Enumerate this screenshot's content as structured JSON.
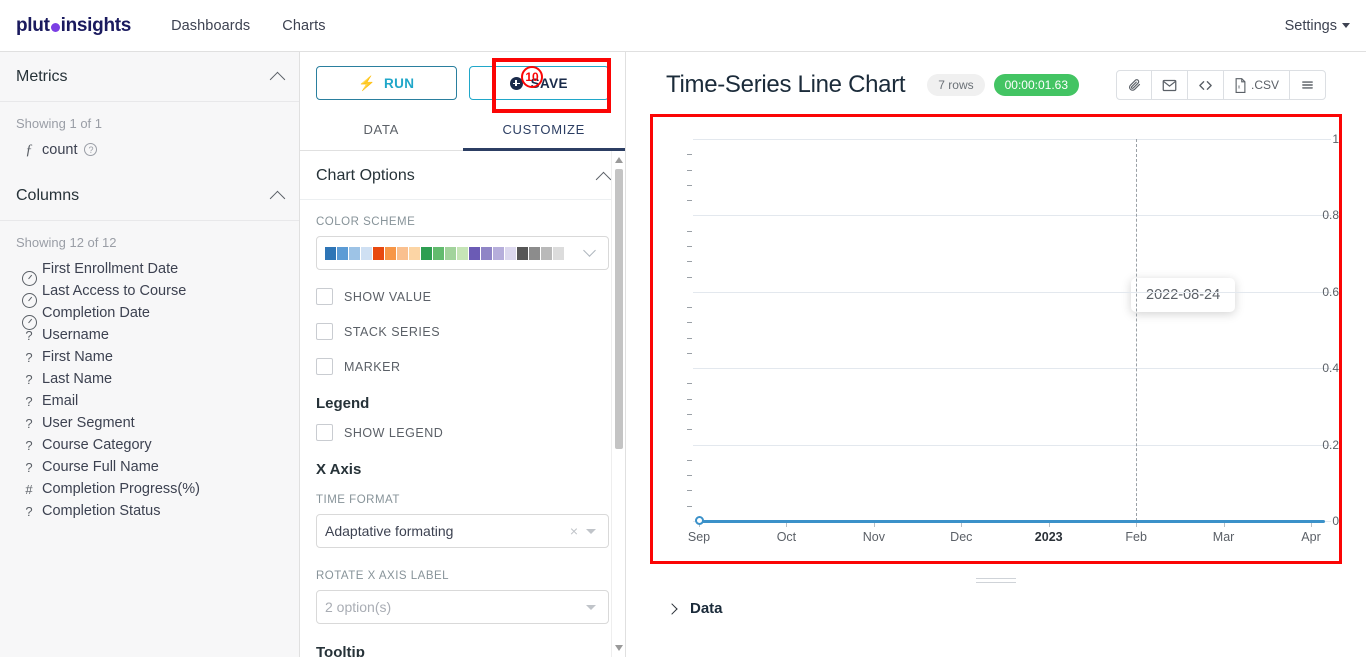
{
  "navbar": {
    "logo_pre": "plut",
    "logo_post": " insights",
    "links": [
      {
        "label": "Dashboards"
      },
      {
        "label": "Charts"
      }
    ],
    "settings_label": "Settings"
  },
  "sidebar": {
    "metrics": {
      "title": "Metrics",
      "showing": "Showing 1 of 1",
      "items": [
        {
          "icon": "function-icon",
          "kind": "fx",
          "label": "count",
          "help": "?"
        }
      ]
    },
    "columns": {
      "title": "Columns",
      "showing": "Showing 12 of 12",
      "items": [
        {
          "icon": "clock-icon",
          "kind": "clock",
          "glyph": "",
          "label": "First Enrollment Date"
        },
        {
          "icon": "clock-icon",
          "kind": "clock",
          "glyph": "",
          "label": "Last Access to Course"
        },
        {
          "icon": "clock-icon",
          "kind": "clock",
          "glyph": "",
          "label": "Completion Date"
        },
        {
          "icon": "string-icon",
          "kind": "str",
          "glyph": "?",
          "label": "Username"
        },
        {
          "icon": "string-icon",
          "kind": "str",
          "glyph": "?",
          "label": "First Name"
        },
        {
          "icon": "string-icon",
          "kind": "str",
          "glyph": "?",
          "label": "Last Name"
        },
        {
          "icon": "string-icon",
          "kind": "str",
          "glyph": "?",
          "label": "Email"
        },
        {
          "icon": "string-icon",
          "kind": "str",
          "glyph": "?",
          "label": "User Segment"
        },
        {
          "icon": "string-icon",
          "kind": "str",
          "glyph": "?",
          "label": "Course Category"
        },
        {
          "icon": "string-icon",
          "kind": "str",
          "glyph": "?",
          "label": "Course Full Name"
        },
        {
          "icon": "number-icon",
          "kind": "num",
          "glyph": "#",
          "label": "Completion Progress(%)"
        },
        {
          "icon": "string-icon",
          "kind": "str",
          "glyph": "?",
          "label": "Completion Status"
        }
      ]
    }
  },
  "control_panel": {
    "run_label": "RUN",
    "save_label": "SAVE",
    "tabs": [
      {
        "label": "DATA",
        "active": false
      },
      {
        "label": "CUSTOMIZE",
        "active": true
      }
    ],
    "chart_options": {
      "title": "Chart Options",
      "color_scheme_label": "COLOR SCHEME",
      "color_scheme_swatches": [
        "#2e75b6",
        "#5b9bd5",
        "#9dc3e6",
        "#cfe0f3",
        "#e8490f",
        "#f79646",
        "#fac08f",
        "#fcd5a5",
        "#2e9e52",
        "#62bb6e",
        "#a2d39c",
        "#c6e5b7",
        "#6b5bb5",
        "#8f85c6",
        "#b6aedb",
        "#dcd8ee",
        "#565656",
        "#8c8c8c",
        "#b9b9b9",
        "#dcdcdc"
      ],
      "checkboxes": [
        {
          "label": "SHOW VALUE",
          "checked": false
        },
        {
          "label": "STACK SERIES",
          "checked": false
        },
        {
          "label": "MARKER",
          "checked": false
        }
      ]
    },
    "legend": {
      "title": "Legend",
      "show_legend_label": "SHOW LEGEND",
      "show_legend_checked": false
    },
    "x_axis": {
      "title": "X Axis",
      "time_format_label": "TIME FORMAT",
      "time_format_value": "Adaptative formating",
      "rotate_label": "ROTATE X AXIS LABEL",
      "rotate_placeholder": "2 option(s)"
    },
    "tooltip_title": "Tooltip"
  },
  "chart": {
    "title": "Time-Series Line Chart",
    "rows_badge": "7 rows",
    "time_badge": "00:00:01.63",
    "toolbar": [
      {
        "name": "link-icon",
        "glyph": "✁",
        "label": ""
      },
      {
        "name": "email-icon",
        "glyph": "✉",
        "label": ""
      },
      {
        "name": "code-icon",
        "glyph": "<>",
        "label": ""
      },
      {
        "name": "csv-icon",
        "glyph": "⬚",
        "label": ".CSV"
      },
      {
        "name": "menu-icon",
        "glyph": "≡",
        "label": ""
      }
    ],
    "tooltip_value": "2022-08-24",
    "data_section_label": "Data"
  },
  "annotations": {
    "save_badge_number": "10",
    "highlight_color": "#fb0505"
  },
  "chart_data": {
    "type": "line",
    "title": "Time-Series Line Chart",
    "xlabel": "",
    "ylabel": "",
    "ylim": [
      0,
      1
    ],
    "yticks": [
      0,
      0.2,
      0.4,
      0.6,
      0.8,
      1
    ],
    "ytick_labels": [
      "0",
      "0.2",
      "0.4",
      "0.6",
      "0.8",
      "1"
    ],
    "xtick_labels": [
      "Sep",
      "Oct",
      "Nov",
      "Dec",
      "2023",
      "Feb",
      "Mar",
      "Apr"
    ],
    "xtick_bold": [
      "2023"
    ],
    "grid": true,
    "legend": false,
    "series": [
      {
        "name": "count",
        "color": "#3b91c9",
        "x": [
          "Sep",
          "Oct",
          "Nov",
          "Dec",
          "2023",
          "Feb",
          "Mar",
          "Apr"
        ],
        "values": [
          0,
          0,
          0,
          0,
          0,
          0,
          0,
          0
        ]
      }
    ],
    "annotations": [
      {
        "type": "crosshair",
        "x": "Feb",
        "style": "dashed"
      },
      {
        "type": "tooltip",
        "text": "2022-08-24"
      }
    ]
  }
}
